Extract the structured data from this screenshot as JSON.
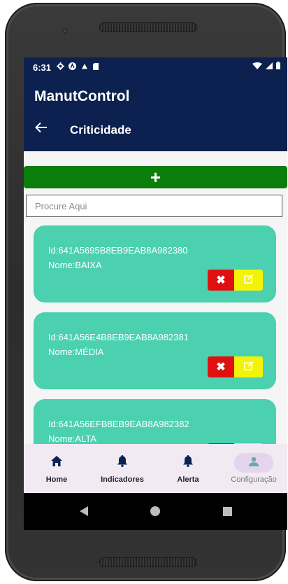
{
  "status": {
    "time": "6:31"
  },
  "app": {
    "title": "ManutControl"
  },
  "page": {
    "title": "Criticidade"
  },
  "toolbar": {
    "add_label": "+"
  },
  "search": {
    "placeholder": "Procure Aqui",
    "value": ""
  },
  "items": [
    {
      "id_text": "Id:641A5695B8EB9EAB8A982380",
      "name_text": "Nome:BAIXA"
    },
    {
      "id_text": "Id:641A56E4B8EB9EAB8A982381",
      "name_text": "Nome:MÉDIA"
    },
    {
      "id_text": "Id:641A56EFB8EB9EAB8A982382",
      "name_text": "Nome:ALTA"
    }
  ],
  "actions": {
    "delete_label": "✖"
  },
  "nav": [
    {
      "label": "Home",
      "icon": "home-icon"
    },
    {
      "label": "Indicadores",
      "icon": "bell-icon"
    },
    {
      "label": "Alerta",
      "icon": "bell-icon"
    },
    {
      "label": "Configuração",
      "icon": "person-icon",
      "active": true
    }
  ],
  "colors": {
    "appbar": "#0c2150",
    "add_button": "#0a7d0a",
    "card": "#4bd0b0",
    "delete": "#e01010",
    "edit": "#f3f30a",
    "nav_bg": "#f1eaf3"
  }
}
